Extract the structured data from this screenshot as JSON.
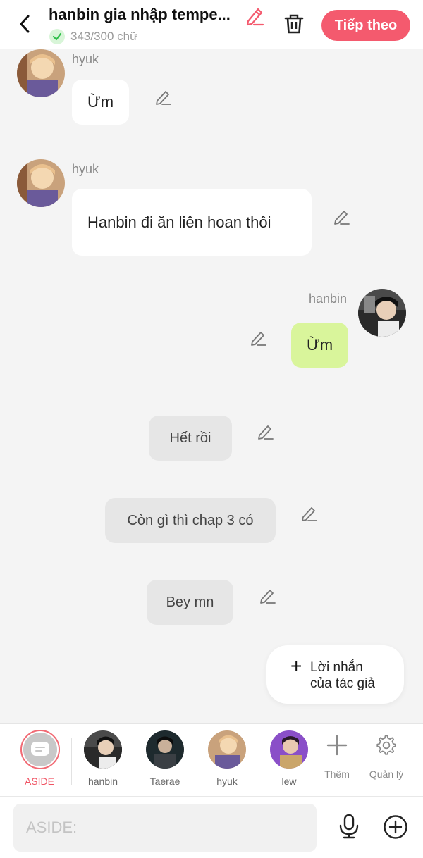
{
  "header": {
    "title": "hanbin gia nhập tempe...",
    "word_count": "343/300 chữ",
    "next_label": "Tiếp theo"
  },
  "messages": [
    {
      "sender": "hyuk",
      "text": "Ừm"
    },
    {
      "sender": "hyuk",
      "text": "Hanbin đi ăn liên hoan thôi"
    },
    {
      "sender": "hanbin",
      "text": "Ừm"
    }
  ],
  "narration": [
    {
      "text": "Hết rồi"
    },
    {
      "text": "Còn gì thì chap 3 có"
    },
    {
      "text": "Bey mn"
    }
  ],
  "author_note": {
    "line1": "Lời nhắn",
    "line2": "của tác giả"
  },
  "characters": {
    "aside": "ASIDE",
    "items": [
      "hanbin",
      "Taerae",
      "hyuk",
      "lew"
    ],
    "add_label": "Thêm",
    "manage_label": "Quản lý"
  },
  "input": {
    "placeholder": "ASIDE:"
  },
  "colors": {
    "accent": "#f45a6e",
    "right_bubble": "#d9f59b",
    "narration_bubble": "#e6e6e6"
  },
  "icons": [
    "back-icon",
    "pencil-icon",
    "check-icon",
    "trash-icon",
    "message-icon",
    "plus-icon",
    "gear-icon",
    "mic-icon",
    "add-circle-icon"
  ]
}
